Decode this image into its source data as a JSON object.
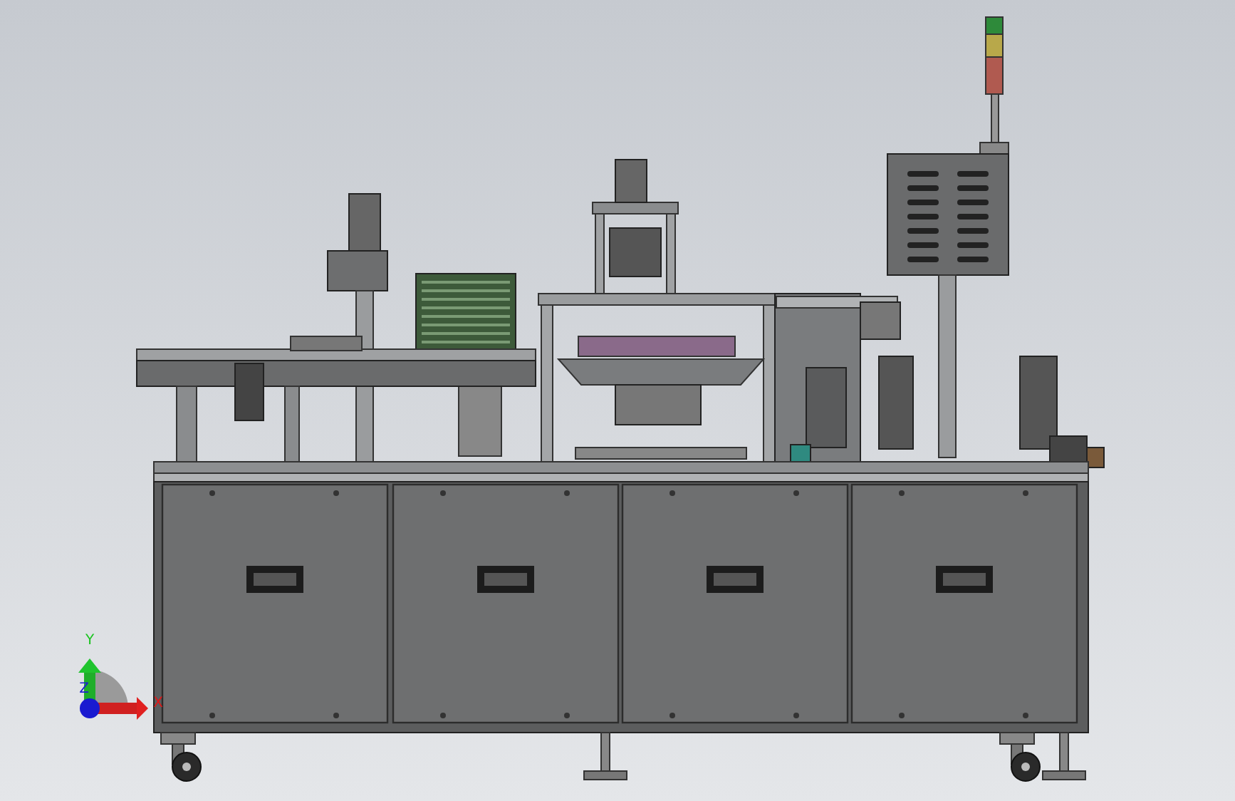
{
  "axis_triad": {
    "labels": [
      {
        "kind": "y",
        "label": "Y"
      },
      {
        "kind": "x",
        "label": "X"
      },
      {
        "kind": "z",
        "label": "Z"
      }
    ]
  }
}
